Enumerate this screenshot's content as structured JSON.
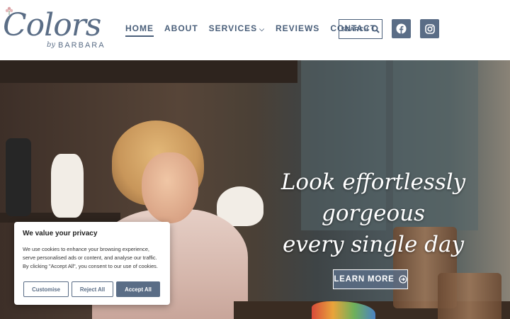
{
  "logo": {
    "script_text": "Colors",
    "by_text": "by",
    "name_text": "BARBARA"
  },
  "nav": {
    "items": [
      {
        "label": "HOME",
        "active": true
      },
      {
        "label": "ABOUT"
      },
      {
        "label": "SERVICES",
        "has_dropdown": true
      },
      {
        "label": "REVIEWS"
      },
      {
        "label": "CONTACT"
      }
    ]
  },
  "search": {
    "label": "SEARCH",
    "icon": "search-icon"
  },
  "social": [
    {
      "name": "facebook",
      "icon": "facebook-icon"
    },
    {
      "name": "instagram",
      "icon": "instagram-icon"
    }
  ],
  "hero": {
    "headline_line1": "Look effortlessly gorgeous",
    "headline_line2": "every single day",
    "cta_label": "LEARN MORE",
    "cta_icon": "arrow-circle-right-icon"
  },
  "cookie": {
    "title": "We value your privacy",
    "body": "We use cookies to enhance your browsing experience, serve personalised ads or content, and analyse our traffic. By clicking \"Accept All\", you consent to our use of cookies.",
    "customise_label": "Customise",
    "reject_label": "Reject All",
    "accept_label": "Accept All"
  },
  "colors": {
    "brand": "#5a6d86",
    "nav_text": "#4a5f7a",
    "white": "#ffffff"
  }
}
